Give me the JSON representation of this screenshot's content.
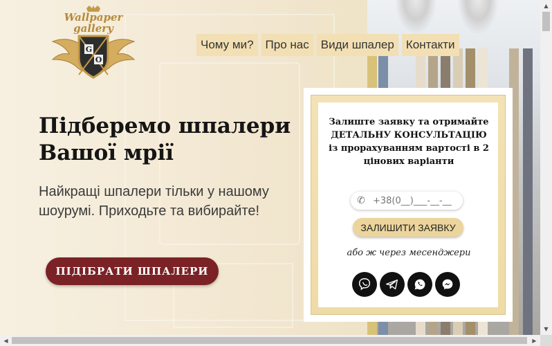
{
  "logo": {
    "line1": "Wallpaper",
    "line2": "gallery",
    "monogram_left": "G",
    "monogram_right": "O"
  },
  "nav": {
    "items": [
      {
        "label": "Чому ми?"
      },
      {
        "label": "Про нас"
      },
      {
        "label": "Види шпалер"
      },
      {
        "label": "Контакти"
      }
    ]
  },
  "hero": {
    "title": "Підберемо шпалери Вашої мрії",
    "subtitle": "Найкращі шпалери тільки у нашому шоурумі. Приходьте та вибирайте!",
    "cta_label": "ПІДІБРАТИ ШПАЛЕРИ"
  },
  "form": {
    "heading": "Залиште заявку та отримайте ДЕТАЛЬНУ КОНСУЛЬТАЦІЮ із прорахуванням вартості в 2 цінових варіанти",
    "phone_placeholder": "+38(0__)___-__-__",
    "submit_label": "ЗАЛИШИТИ ЗАЯВКУ",
    "or_text": "або ж через месенджери",
    "messengers": [
      "viber-icon",
      "telegram-icon",
      "whatsapp-icon",
      "messenger-icon"
    ]
  },
  "colors": {
    "accent_burgundy": "#7b2226",
    "nav_bg": "#f2dfb3",
    "button_gold": "#ecd59c",
    "logo_gold": "#b58a3c"
  }
}
